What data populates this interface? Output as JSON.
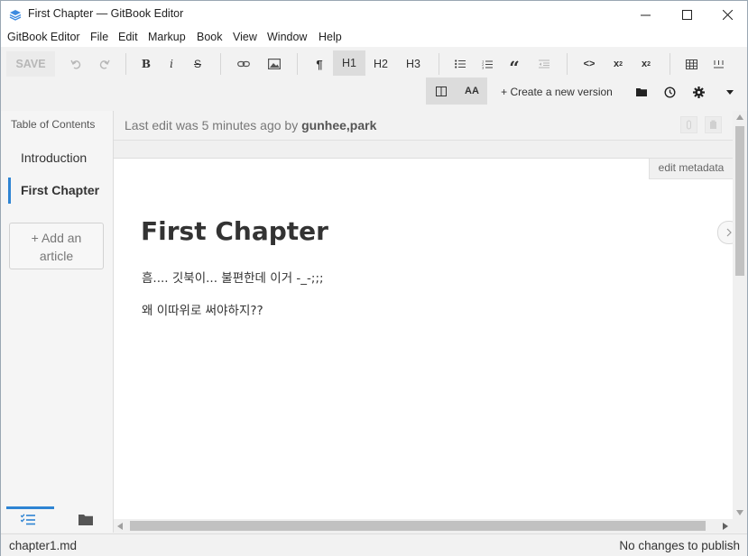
{
  "window": {
    "title": "First Chapter — GitBook Editor",
    "controls": [
      "minimize-icon",
      "maximize-icon",
      "close-icon"
    ]
  },
  "menu": [
    "GitBook Editor",
    "File",
    "Edit",
    "Markup",
    "Book",
    "View",
    "Window",
    "Help"
  ],
  "toolbar": {
    "save": "SAVE",
    "bold": "B",
    "italic": "i",
    "strike": "S",
    "paragraph": "¶",
    "h1": "H1",
    "h2": "H2",
    "h3": "H3",
    "quote": "“",
    "code": "<>",
    "subscript": "x",
    "subscript_mark": "2",
    "superscript": "x",
    "superscript_mark": "2",
    "font_size": "AA",
    "create_version": "+ Create a new version",
    "active_heading": "H1"
  },
  "sidebar": {
    "title": "Table of Contents",
    "items": [
      {
        "label": "Introduction",
        "active": false
      },
      {
        "label": "First Chapter",
        "active": true
      }
    ],
    "add_article": "+ Add an article",
    "tabs": [
      "checklist-icon",
      "folder-icon"
    ]
  },
  "editinfo": {
    "prefix": "Last edit was 5 minutes ago by ",
    "author": "gunhee,park"
  },
  "editor": {
    "metadata_button": "edit metadata",
    "title": "First Chapter",
    "paragraphs": [
      "흠.... 깃북이... 불편한데 이거 -_-;;;",
      "왜 이따위로 써야하지??"
    ]
  },
  "status": {
    "file": "chapter1.md",
    "publish": "No changes to publish"
  },
  "colors": {
    "accent": "#2e84d3",
    "active_button_bg": "#dcdcdc"
  }
}
